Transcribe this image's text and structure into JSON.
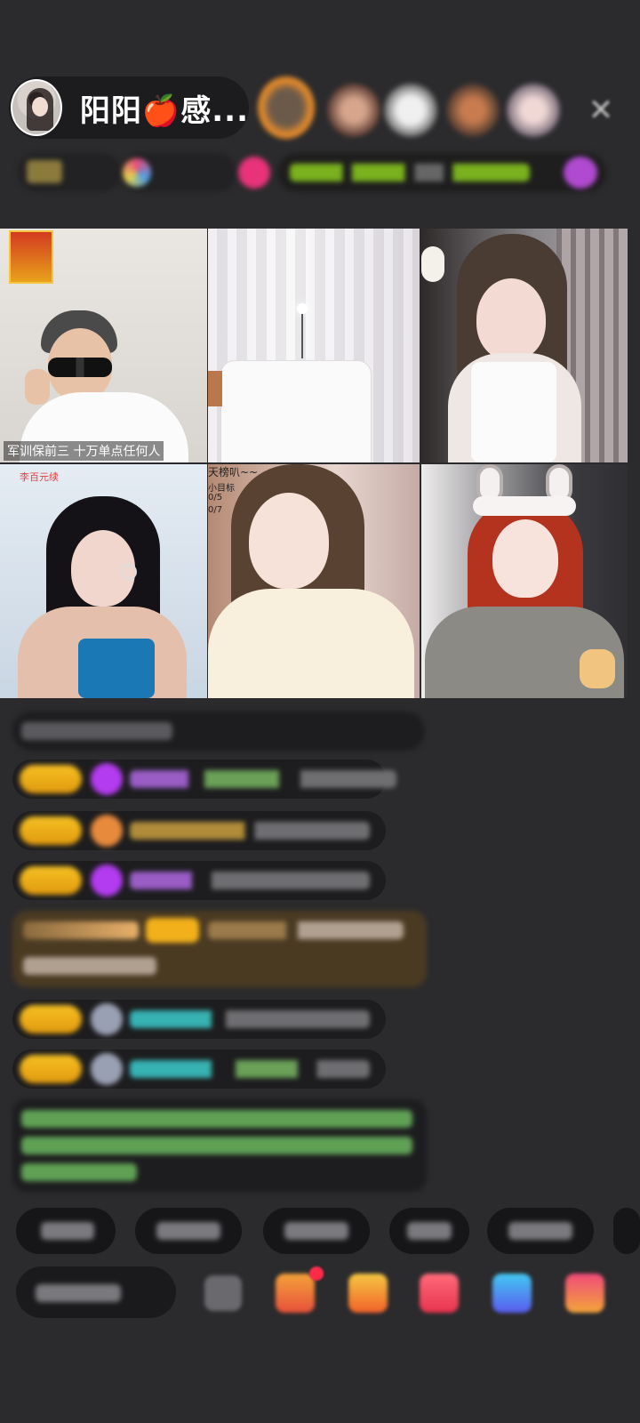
{
  "host": {
    "name": "阳阳🍎感..."
  },
  "top_controls": {
    "close_glyph": "✕"
  },
  "video_grid": {
    "cells": [
      {
        "caption": "军训保前三  十万单点任何人"
      },
      {
        "caption": ""
      },
      {
        "caption": ""
      },
      {
        "caption": "李百元续"
      },
      {
        "caption": "天榜叭~~",
        "sub1": "小目标",
        "sub2": "0/5",
        "sub3": "0/7"
      },
      {
        "caption": ""
      }
    ]
  },
  "colors": {
    "background": "#2b2b2d",
    "pill": "#1c1c1e",
    "level_badge": "#f2b01b",
    "purple_badge": "#b33cf0",
    "green_text": "#7bd36b",
    "teal_text": "#37b3b3"
  }
}
